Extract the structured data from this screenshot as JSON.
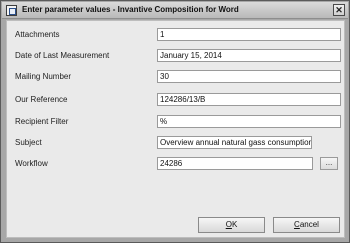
{
  "window": {
    "title": "Enter parameter values - Invantive Composition for Word",
    "close_glyph": "✕"
  },
  "params": [
    {
      "label": "Attachments",
      "value": "1"
    },
    {
      "label": "Date of Last Measurement",
      "value": "January 15, 2014"
    },
    {
      "label": "Mailing Number",
      "value": "30"
    },
    {
      "label": "Our Reference",
      "value": "124286/13/B"
    },
    {
      "label": "Recipient Filter",
      "value": "%"
    },
    {
      "label": "Subject",
      "value": "Overview annual natural gass consumption"
    },
    {
      "label": "Workflow",
      "value": "24286"
    }
  ],
  "workflow_browse_label": "...",
  "buttons": {
    "ok_mnemonic": "O",
    "ok_rest": "K",
    "cancel_mnemonic": "C",
    "cancel_rest": "ancel"
  }
}
